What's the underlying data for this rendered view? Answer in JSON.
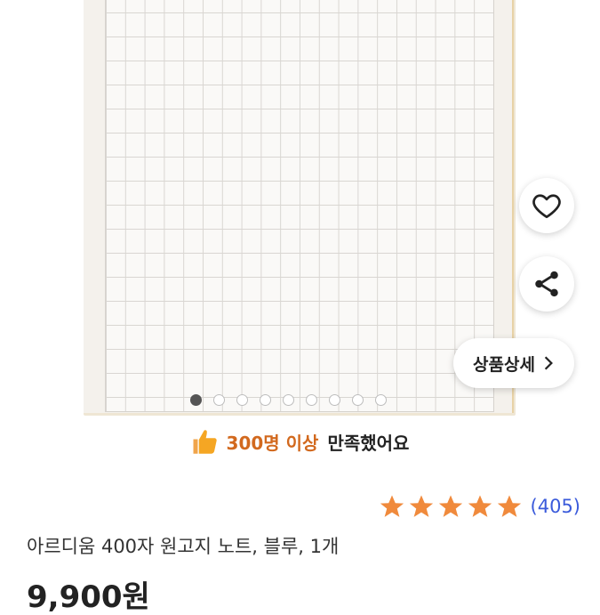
{
  "gallery": {
    "image_alt": "400자 원고지 노트",
    "dot_count": 9,
    "active_index": 0
  },
  "actions": {
    "heart_icon": "heart-outline-icon",
    "share_icon": "share-icon",
    "detail_label": "상품상세",
    "detail_icon": "chevron-right-icon"
  },
  "satisfaction": {
    "icon": "thumbs-up-icon",
    "highlight": "300명 이상",
    "text": "만족했어요"
  },
  "rating": {
    "stars": 5,
    "count": "(405)",
    "star_color": "#f08a3c"
  },
  "product": {
    "title": "아르디움 400자 원고지 노트, 블루, 1개",
    "price_partial": "9,900원"
  },
  "colors": {
    "accent_orange": "#d2691e",
    "link_blue": "#3b5bdb"
  }
}
